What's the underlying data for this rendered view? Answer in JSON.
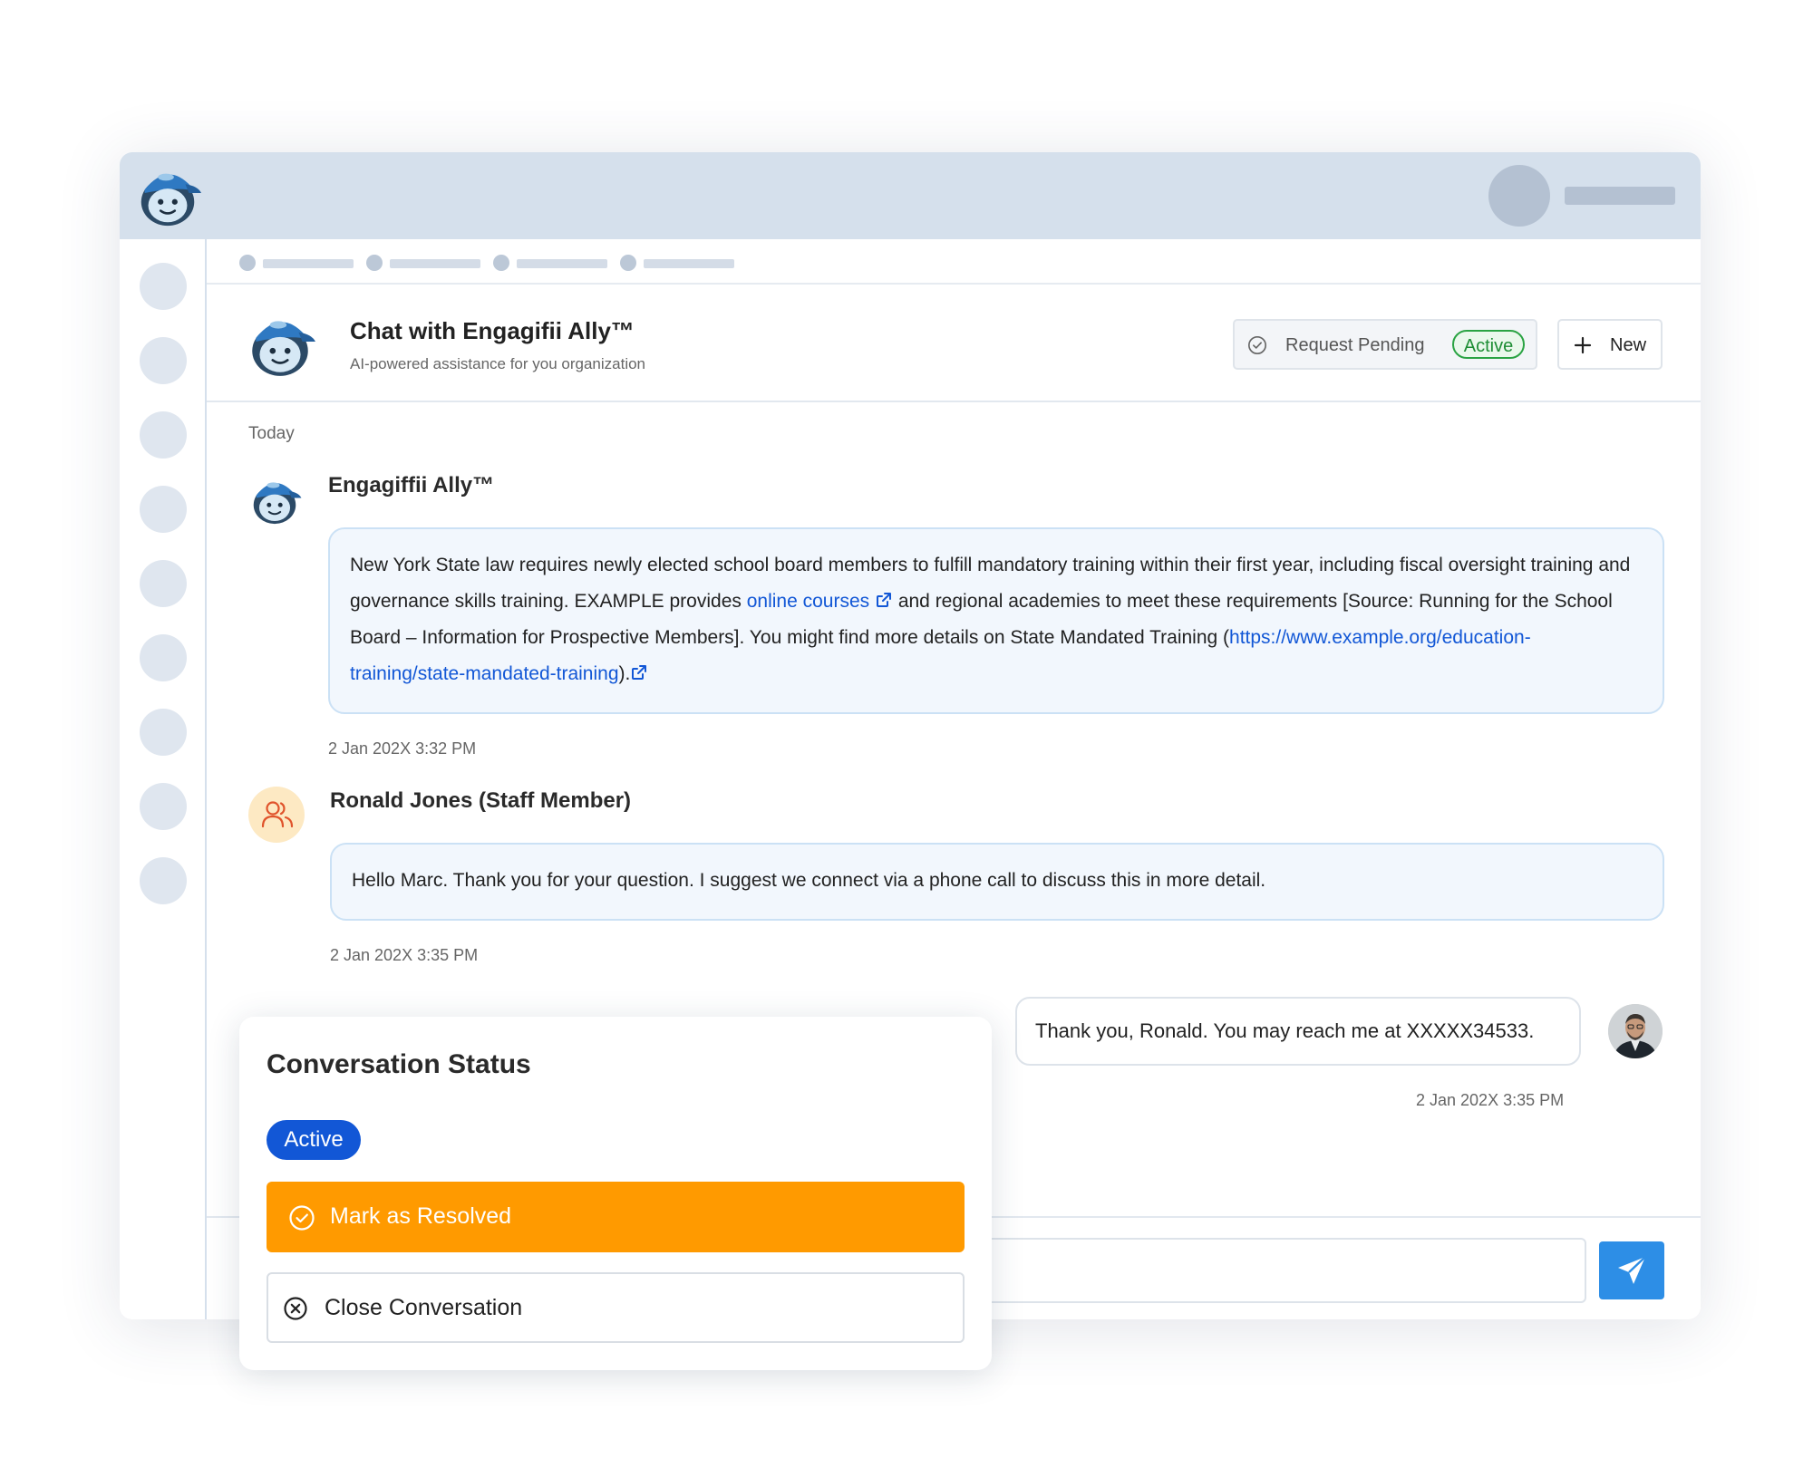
{
  "chat": {
    "title": "Chat with Engagifii Ally™",
    "subtitle": "AI-powered assistance for you organization",
    "status_pending_label": "Request Pending",
    "status_active_label": "Active",
    "new_button_label": "New"
  },
  "messages": {
    "day_label": "Today",
    "bot": {
      "sender": "Engagiffii Ally™",
      "text_part1": "New York State law requires newly elected school board members to fulfill mandatory training within their first year, including fiscal oversight training and governance skills training. EXAMPLE provides ",
      "link1": "online courses",
      "text_part2": "  and regional academies to meet these requirements [Source: Running for the School Board – Information for Prospective Members]. You might find more details on State Mandated Training (",
      "link2": "https://www.example.org/education-training/state-mandated-training",
      "text_part3": ").",
      "timestamp": "2 Jan 202X 3:32 PM"
    },
    "staff": {
      "sender": "Ronald Jones (Staff Member)",
      "text": "Hello Marc. Thank you for your question. I suggest we connect via a phone call to discuss this in more detail.",
      "timestamp": "2 Jan 202X 3:35 PM"
    },
    "user": {
      "text": "Thank you, Ronald. You may reach me at XXXXX34533.",
      "timestamp": "2 Jan 202X 3:35 PM"
    }
  },
  "status_card": {
    "title": "Conversation Status",
    "current_status": "Active",
    "resolve_label": "Mark as Resolved",
    "close_label": "Close Conversation"
  },
  "icons": {
    "pending": "check-circle-icon",
    "new": "plus-icon",
    "external_link": "external-link-icon",
    "staff": "users-icon",
    "send": "send-icon",
    "resolve": "check-circle-icon",
    "close": "x-circle-icon"
  },
  "colors": {
    "accent_blue": "#1257d6",
    "send_blue": "#2d8ee6",
    "resolve_orange": "#ff9a00",
    "active_green": "#2aa343",
    "topbar": "#d5e0ec"
  }
}
